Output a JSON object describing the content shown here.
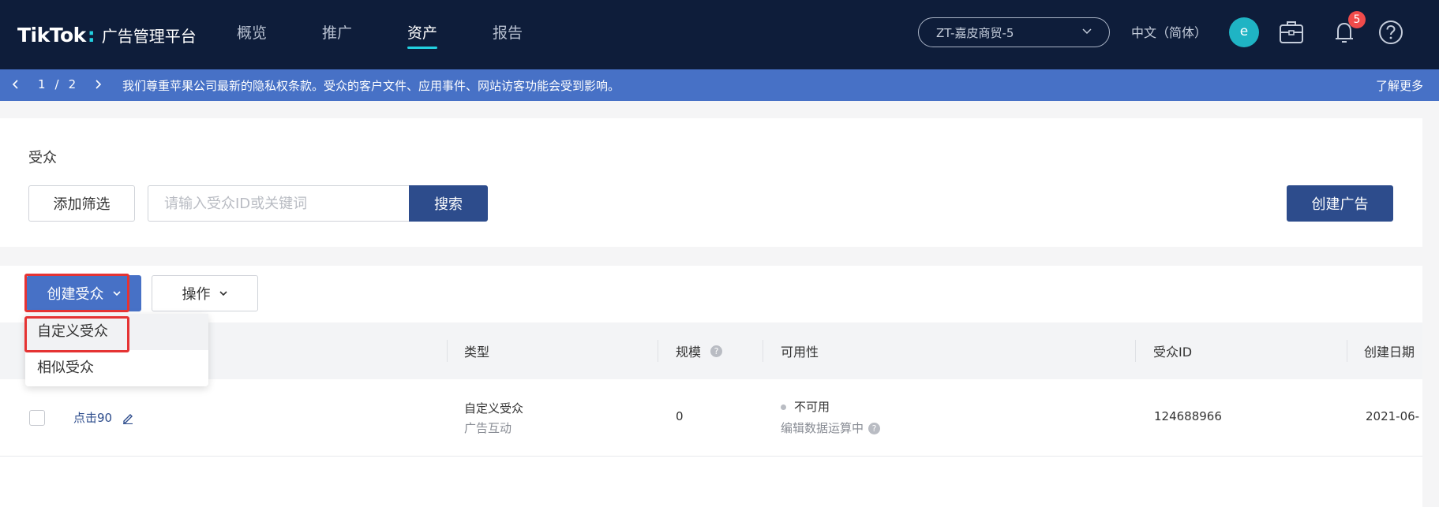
{
  "header": {
    "logo": {
      "mark": "TikTok",
      "colon": ":",
      "subtitle": "广告管理平台"
    },
    "tabs": [
      {
        "label": "概览",
        "active": false
      },
      {
        "label": "推广",
        "active": false
      },
      {
        "label": "资产",
        "active": true
      },
      {
        "label": "报告",
        "active": false
      }
    ],
    "account": "ZT-嘉皮商贸-5",
    "language": "中文（简体）",
    "avatar_letter": "e",
    "notification_count": "5",
    "accent_color": "#22d0e0"
  },
  "banner": {
    "prev_icon": "chevron-left-icon",
    "page_current": "1",
    "page_sep": "/",
    "page_total": "2",
    "next_icon": "chevron-right-icon",
    "message": "我们尊重苹果公司最新的隐私权条款。受众的客户文件、应用事件、网站访客功能会受到影响。",
    "learn_more": "了解更多"
  },
  "filter": {
    "title": "受众",
    "add_filter": "添加筛选",
    "search_placeholder": "请输入受众ID或关键词",
    "search_button": "搜索",
    "create_ad": "创建广告"
  },
  "toolbar": {
    "create_audience": "创建受众",
    "actions": "操作"
  },
  "dropdown": {
    "items": [
      "自定义受众",
      "相似受众"
    ]
  },
  "table": {
    "columns": [
      "类型",
      "规模",
      "可用性",
      "受众ID",
      "创建日期"
    ],
    "rows": [
      {
        "name": "点击90",
        "type": "自定义受众",
        "type_sub": "广告互动",
        "size": "0",
        "availability": "不可用",
        "availability_sub": "编辑数据运算中",
        "audience_id": "124688966",
        "created": "2021-06-"
      }
    ]
  }
}
